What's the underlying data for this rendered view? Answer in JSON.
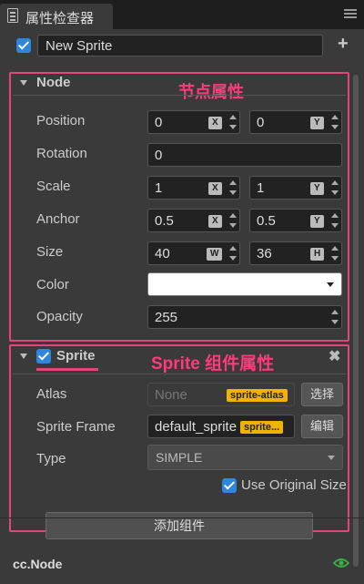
{
  "tab": {
    "title": "属性检查器",
    "icon": "inspector-icon",
    "menu_icon": "menu-icon"
  },
  "node": {
    "active": true,
    "name": "New Sprite",
    "add_icon": "plus-icon"
  },
  "node_section": {
    "title": "Node",
    "note": "节点属性",
    "props": {
      "position": {
        "label": "Position",
        "x": "0",
        "y": "0",
        "x_axis": "X",
        "y_axis": "Y"
      },
      "rotation": {
        "label": "Rotation",
        "value": "0"
      },
      "scale": {
        "label": "Scale",
        "x": "1",
        "y": "1",
        "x_axis": "X",
        "y_axis": "Y"
      },
      "anchor": {
        "label": "Anchor",
        "x": "0.5",
        "y": "0.5",
        "x_axis": "X",
        "y_axis": "Y"
      },
      "size": {
        "label": "Size",
        "w": "40",
        "h": "36",
        "w_axis": "W",
        "h_axis": "H"
      },
      "color": {
        "label": "Color",
        "value": "#ffffff"
      },
      "opacity": {
        "label": "Opacity",
        "value": "255"
      }
    }
  },
  "sprite_section": {
    "title": "Sprite",
    "enabled": true,
    "note": "Sprite 组件属性",
    "remove_icon": "close-icon",
    "atlas": {
      "label": "Atlas",
      "value": "None",
      "tag": "sprite-atlas",
      "button": "选择"
    },
    "sprite_frame": {
      "label": "Sprite Frame",
      "value": "default_sprite",
      "tag": "sprite...",
      "button": "编辑"
    },
    "type": {
      "label": "Type",
      "value": "SIMPLE"
    },
    "use_original_size": {
      "label": "Use Original Size",
      "checked": true
    }
  },
  "add_component_button": "添加组件",
  "footer": {
    "label": "cc.Node",
    "icon": "eye-icon"
  },
  "colors": {
    "accent_blue": "#2e86de",
    "highlight_pink": "#e0457b",
    "note_pink": "#ff3a7c",
    "tag_yellow": "#f0b400",
    "eye_green": "#3cb043"
  }
}
